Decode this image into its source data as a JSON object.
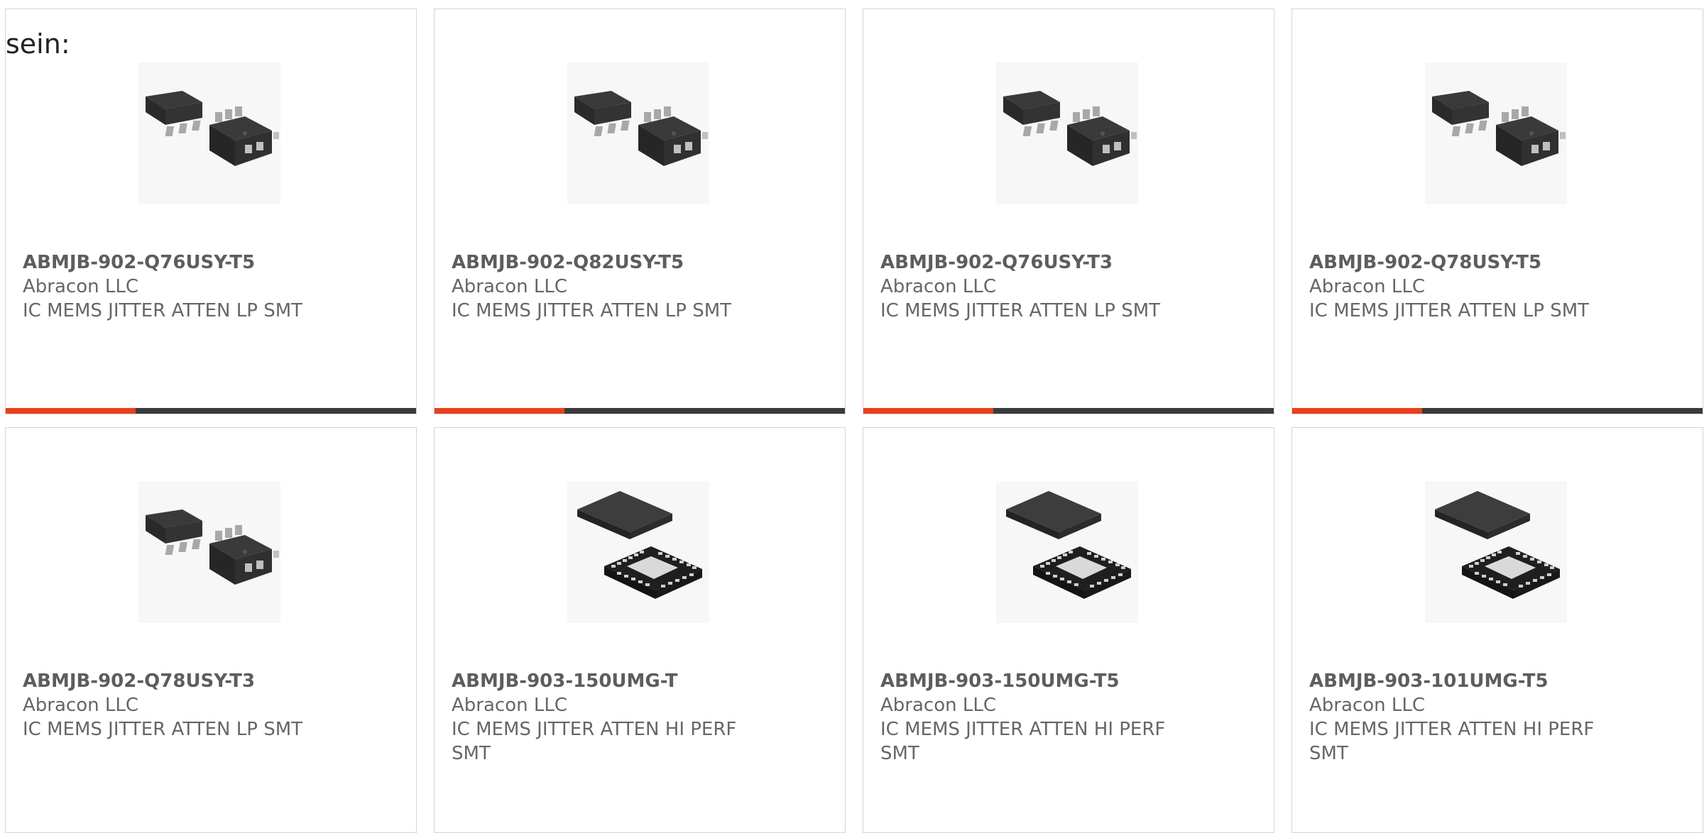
{
  "intro_text": "sein:",
  "colors": {
    "accent": "#e8401c",
    "bar": "#3b3b3b",
    "border": "#d4d4d4",
    "text": "#666666"
  },
  "products": [
    {
      "part_number": "ABMJB-902-Q76USY-T5",
      "manufacturer": "Abracon LLC",
      "description": "IC MEMS JITTER ATTEN LP SMT",
      "image_icon": "sot-package-icon",
      "highlighted": true
    },
    {
      "part_number": "ABMJB-902-Q82USY-T5",
      "manufacturer": "Abracon LLC",
      "description": "IC MEMS JITTER ATTEN LP SMT",
      "image_icon": "sot-package-icon",
      "highlighted": true
    },
    {
      "part_number": "ABMJB-902-Q76USY-T3",
      "manufacturer": "Abracon LLC",
      "description": "IC MEMS JITTER ATTEN LP SMT",
      "image_icon": "sot-package-icon",
      "highlighted": true
    },
    {
      "part_number": "ABMJB-902-Q78USY-T5",
      "manufacturer": "Abracon LLC",
      "description": "IC MEMS JITTER ATTEN LP SMT",
      "image_icon": "sot-package-icon",
      "highlighted": true
    },
    {
      "part_number": "ABMJB-902-Q78USY-T3",
      "manufacturer": "Abracon LLC",
      "description": "IC MEMS JITTER ATTEN LP SMT",
      "image_icon": "sot-package-icon",
      "highlighted": false
    },
    {
      "part_number": "ABMJB-903-150UMG-T",
      "manufacturer": "Abracon LLC",
      "description": "IC MEMS JITTER ATTEN HI PERF SMT",
      "image_icon": "qfn-package-icon",
      "highlighted": false
    },
    {
      "part_number": "ABMJB-903-150UMG-T5",
      "manufacturer": "Abracon LLC",
      "description": "IC MEMS JITTER ATTEN HI PERF SMT",
      "image_icon": "qfn-package-icon",
      "highlighted": false
    },
    {
      "part_number": "ABMJB-903-101UMG-T5",
      "manufacturer": "Abracon LLC",
      "description": "IC MEMS JITTER ATTEN HI PERF SMT",
      "image_icon": "qfn-package-icon",
      "highlighted": false
    }
  ]
}
